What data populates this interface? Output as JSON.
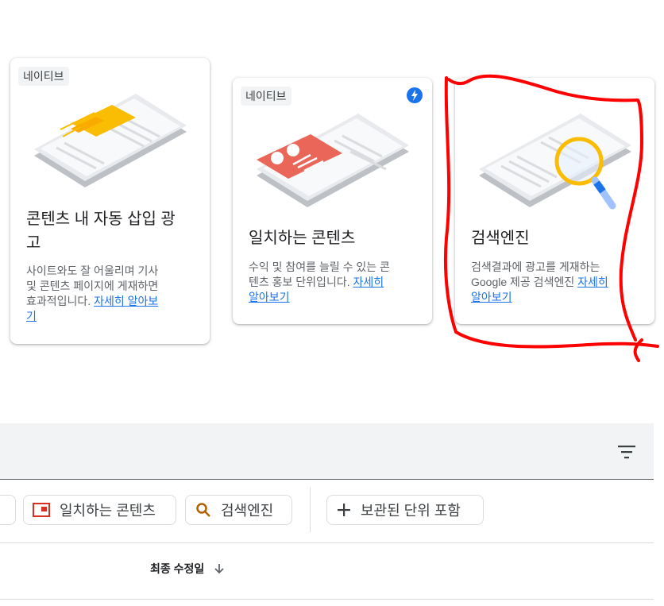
{
  "cards": [
    {
      "badge": "네이티브",
      "title_line1": "콘텐츠 내 자동 삽입 광",
      "title_line2": "고",
      "desc_line1": "사이트와도 잘 어울리며 기사",
      "desc_line2": "및 콘텐츠 페이지에 게재하면",
      "desc_line3_text": "효과적입니다. ",
      "desc_line3_link": "자세히 알아보",
      "desc_line4_link": "기"
    },
    {
      "badge": "네이티브",
      "title": "일치하는 콘텐츠",
      "desc_line1": "수익 및 참여를 늘릴 수 있는 콘",
      "desc_line2_text": "텐츠 홍보 단위입니다. ",
      "desc_line2_link": "자세히",
      "desc_line3_link": "알아보기",
      "icon": "lightning-bolt-icon"
    },
    {
      "title": "검색엔진",
      "desc_line1": "검색결과에 광고를 게재하는",
      "desc_line2_text": "Google 제공 검색엔진 ",
      "desc_line2_link": "자세히",
      "desc_line3_link": "알아보기"
    }
  ],
  "filters": {
    "chip_matched": "일치하는 콘텐츠",
    "chip_search": "검색엔진",
    "chip_archived": "보관된 단위 포함"
  },
  "table": {
    "col_last_modified": "최종 수정일"
  },
  "colors": {
    "link": "#1a73e8",
    "annotation": "#ff0000",
    "badge_bg": "#f1f3f4"
  }
}
